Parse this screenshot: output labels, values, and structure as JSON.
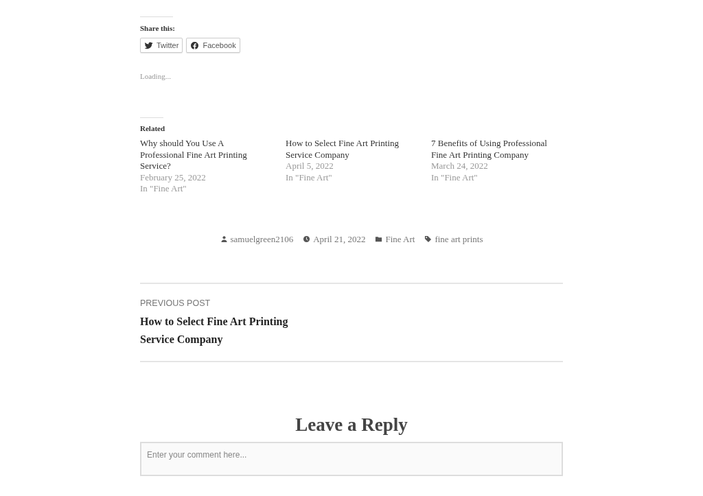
{
  "share": {
    "heading": "Share this:",
    "buttons": [
      {
        "kind": "twitter",
        "label": "Twitter"
      },
      {
        "kind": "facebook",
        "label": "Facebook"
      }
    ]
  },
  "likes": {
    "status": "Loading..."
  },
  "related": {
    "heading": "Related",
    "posts": [
      {
        "title": "Why should You Use A Professional Fine Art Printing Service?",
        "date": "February 25, 2022",
        "category": "In \"Fine Art\""
      },
      {
        "title": "How to Select Fine Art Printing Service Company",
        "date": "April 5, 2022",
        "category": "In \"Fine Art\""
      },
      {
        "title": "7 Benefits of Using Professional Fine Art Printing Company",
        "date": "March 24, 2022",
        "category": "In \"Fine Art\""
      }
    ]
  },
  "meta": [
    {
      "kind": "author",
      "text": "samuelgreen2106"
    },
    {
      "kind": "date",
      "text": "April 21, 2022"
    },
    {
      "kind": "category",
      "text": "Fine Art"
    },
    {
      "kind": "tag",
      "text": "fine art prints"
    }
  ],
  "post_navigation": {
    "label": "PREVIOUS POST",
    "title": "How to Select Fine Art Printing Service Company"
  },
  "reply": {
    "heading": "Leave a Reply",
    "comment": {
      "placeholder": "Enter your comment here..."
    }
  }
}
